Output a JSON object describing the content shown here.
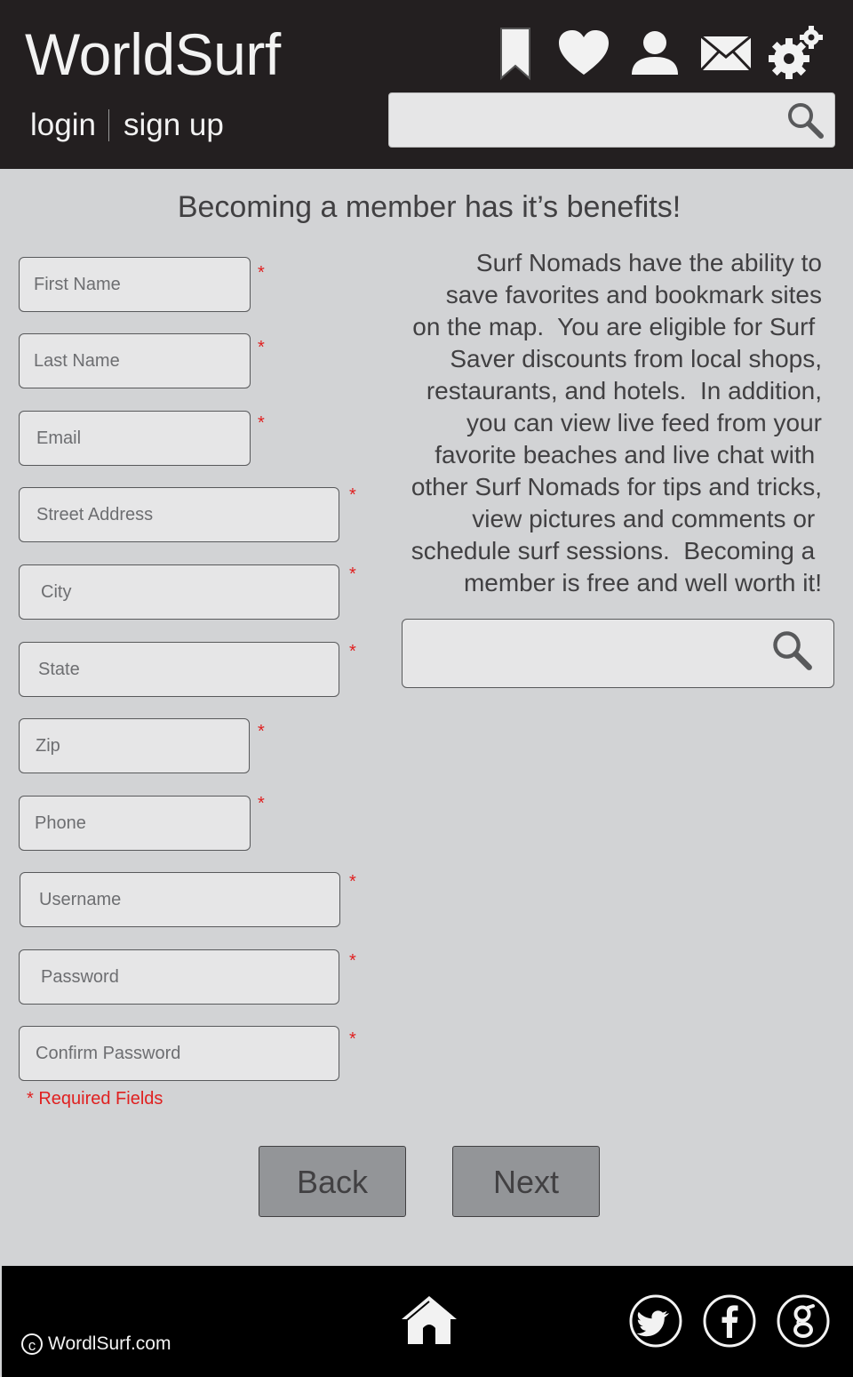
{
  "header": {
    "logo": "WorldSurf",
    "login": "login",
    "signup": "sign up",
    "icons": [
      "bookmark-icon",
      "heart-icon",
      "user-icon",
      "mail-icon",
      "gear-icon"
    ],
    "search_placeholder": ""
  },
  "main": {
    "headline": "Becoming a member has it’s benefits!",
    "benefits_text": "Surf Nomads have the ability to save favorites and bookmark sites on the map.  You are eligible for Surf Saver discounts from local shops, restaurants, and hotels.  In addition, you can view live feed from your favorite beaches and live chat with other Surf Nomads for tips and tricks, view pictures and comments or schedule surf sessions.  Becoming a member is free and well worth it!",
    "benefits_lines": [
      "Surf Nomads have the ability to",
      "save favorites and bookmark sites",
      "on the map.  You are eligible for Surf ",
      "Saver discounts from local shops,",
      "restaurants, and hotels.  In addition,",
      "you can view live feed from your",
      "favorite beaches and live chat with ",
      "other Surf Nomads for tips and tricks,",
      "view pictures and comments or ",
      "schedule surf sessions.  Becoming a ",
      "member is free and well worth it!"
    ],
    "search_placeholder": "",
    "form": {
      "asterisk": "*",
      "first_name": "First Name",
      "last_name": "Last Name",
      "email": "Email",
      "street": "Street Address",
      "city": "City",
      "state": "State",
      "zip": "Zip",
      "phone": "Phone",
      "username": "Username",
      "password": "Password",
      "confirm_password": "Confirm Password",
      "required_note": "* Required Fields"
    },
    "back": "Back",
    "next": "Next"
  },
  "footer": {
    "copyright": "WordlSurf.com",
    "copyright_symbol": "c",
    "icons": [
      "home-icon",
      "twitter-icon",
      "facebook-icon",
      "google-icon"
    ]
  },
  "colors": {
    "header_bg": "#231f20",
    "page_bg": "#d2d3d5",
    "field_bg": "#e6e6e7",
    "button_bg": "#939598",
    "required_red": "#e02020",
    "footer_bg": "#000000"
  }
}
